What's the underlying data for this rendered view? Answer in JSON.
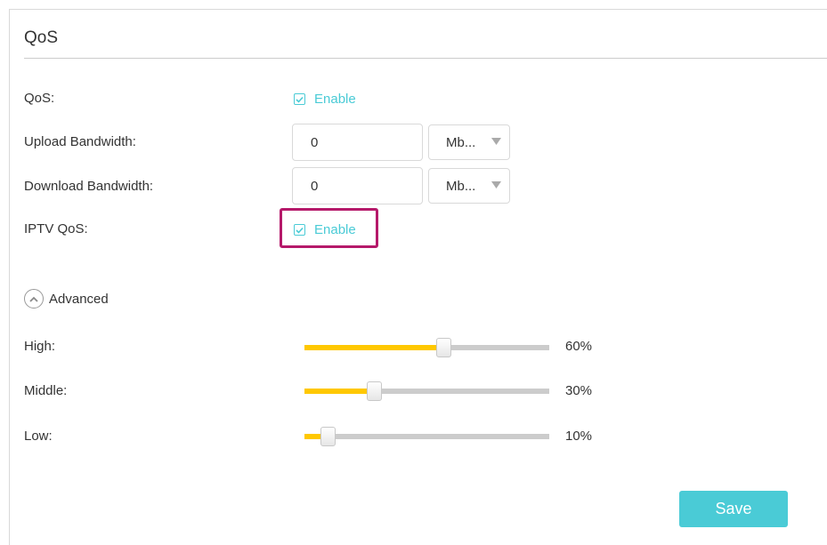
{
  "section": {
    "title": "QoS"
  },
  "qos": {
    "label": "QoS:",
    "checked": true,
    "option_label": "Enable"
  },
  "upload": {
    "label": "Upload Bandwidth:",
    "value": "0",
    "unit": "Mb..."
  },
  "download": {
    "label": "Download Bandwidth:",
    "value": "0",
    "unit": "Mb..."
  },
  "iptv": {
    "label": "IPTV QoS:",
    "checked": true,
    "option_label": "Enable"
  },
  "advanced": {
    "label": "Advanced",
    "icon": "chevron-up-circle-icon"
  },
  "priorities": [
    {
      "label": "High:",
      "percent_text": "60%",
      "value": 0.6
    },
    {
      "label": "Middle:",
      "percent_text": "30%",
      "value": 0.3
    },
    {
      "label": "Low:",
      "percent_text": "10%",
      "value": 0.1
    }
  ],
  "save": {
    "label": "Save"
  },
  "colors": {
    "accent": "#4acbd6",
    "slider_fill": "#ffc800",
    "slider_track": "#cccccc",
    "highlight": "#b5196a"
  }
}
